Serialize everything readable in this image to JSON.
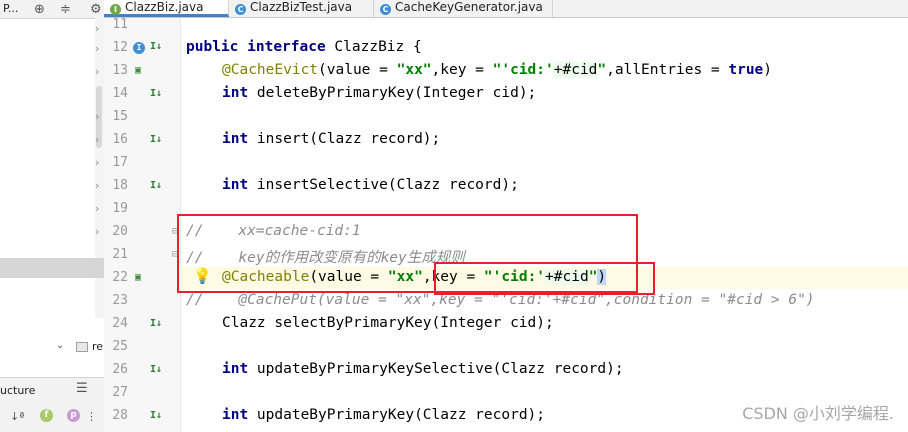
{
  "left_panel": {
    "title": "P...",
    "icons": [
      "target-icon",
      "filter-icon",
      "gear-icon"
    ],
    "tree_item": "re",
    "structure_title": "ucture",
    "structure_icons": [
      "sort-icon",
      "field-icon",
      "property-icon"
    ]
  },
  "tabs": [
    {
      "label": "ClazzBiz.java",
      "icon": "interface-icon",
      "active": true
    },
    {
      "label": "ClazzBizTest.java",
      "icon": "class-icon",
      "active": false
    },
    {
      "label": "CacheKeyGenerator.java",
      "icon": "class-icon",
      "active": false
    }
  ],
  "editor": {
    "line_numbers": [
      "11",
      "12",
      "13",
      "14",
      "15",
      "16",
      "17",
      "18",
      "19",
      "20",
      "21",
      "22",
      "23",
      "24",
      "25",
      "26",
      "27",
      "28"
    ],
    "lines": {
      "l12": {
        "kw1": "public",
        "kw2": "interface",
        "rest": " ClazzBiz {"
      },
      "l13": {
        "ann": "@CacheEvict",
        "p1": "(value = ",
        "s1": "\"xx\"",
        "p2": ",key = ",
        "s2": "\"'cid:'",
        "p3": "+#cid",
        "s3": "\"",
        "p4": ",allEntries = ",
        "kw": "true",
        "p5": ")"
      },
      "l14": {
        "kw": "int",
        "rest": " deleteByPrimaryKey(Integer cid);"
      },
      "l16": {
        "kw": "int",
        "rest": " insert(Clazz record);"
      },
      "l18": {
        "kw": "int",
        "rest": " insertSelective(Clazz record);"
      },
      "l20": {
        "comment": "//    xx=cache-cid:1"
      },
      "l21": {
        "comment": "//    key的作用改变原有的key生成规则"
      },
      "l22": {
        "ann": "@Cacheable",
        "p1": "(value = ",
        "s1": "\"xx\"",
        "p2": ",key = ",
        "s2": "\"'cid:'",
        "p3": "+#cid",
        "s3": "\"",
        "p4": ")"
      },
      "l23": {
        "comment": "//    @CachePut(value = \"xx\",key = \"'cid:'+#cid\",condition = \"#cid > 6\")"
      },
      "l24": {
        "rest": "Clazz selectByPrimaryKey(Integer cid);"
      },
      "l26": {
        "kw": "int",
        "rest": " updateByPrimaryKeySelective(Clazz record);"
      },
      "l28": {
        "kw": "int",
        "rest": " updateByPrimaryKey(Clazz record);"
      }
    }
  },
  "watermark": "CSDN @小刘学编程.",
  "colors": {
    "annotation": "#808000",
    "keyword": "#000080",
    "string": "#008000",
    "comment": "#8c8c8c",
    "highlight_box": "#e8202a",
    "tab_underline": "#4083c9"
  }
}
